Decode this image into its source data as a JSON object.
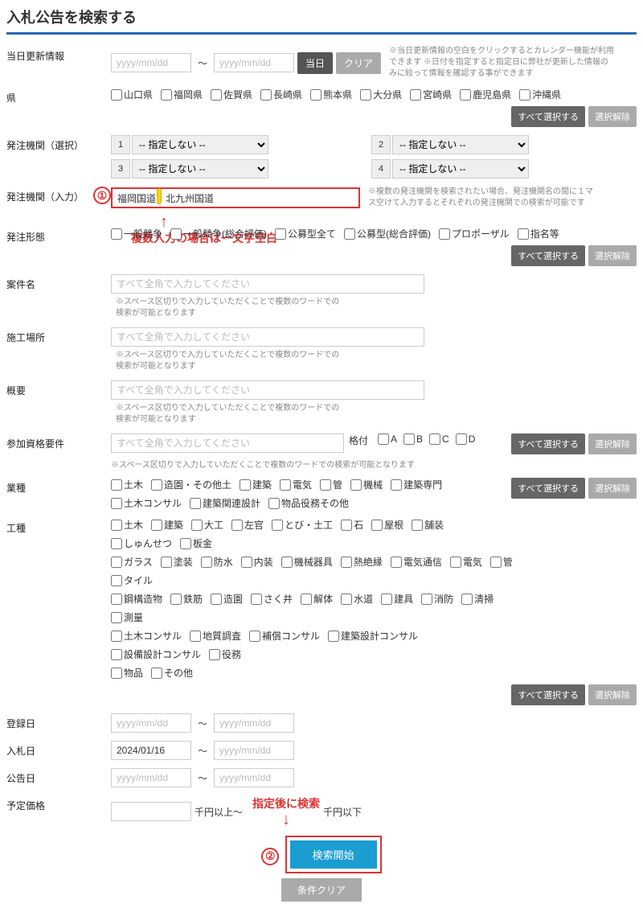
{
  "page_title": "入札公告を検索する",
  "update_info": {
    "label": "当日更新情報",
    "placeholder": "yyyy/mm/dd",
    "today_btn": "当日",
    "clear_btn": "クリア",
    "help": "※当日更新情報の空白をクリックするとカレンダー機能が利用できます\n※日付を指定すると指定日に弊社が更新した情報のみに絞って情報を確認する事ができます"
  },
  "prefectures": {
    "label": "県",
    "items": [
      "山口県",
      "福岡県",
      "佐賀県",
      "長崎県",
      "熊本県",
      "大分県",
      "宮崎県",
      "鹿児島県",
      "沖縄県"
    ],
    "all": "すべて選択する",
    "none": "選択解除"
  },
  "agency_select": {
    "label": "発注機関（選択）",
    "option": "-- 指定しない --",
    "nums": [
      "1",
      "2",
      "3",
      "4"
    ]
  },
  "agency_input": {
    "label": "発注機関（入力）",
    "value": "福岡国道　北九州国道",
    "help": "※複数の発注機関を検索されたい場合、発注機関名の間に１マス空けて入力するとそれぞれの発注機関での検索が可能です",
    "annotation": "複数入力の場合は一文字空白"
  },
  "order_type": {
    "label": "発注形態",
    "items": [
      "一般競争",
      "一般競争(総合評価)",
      "公募型全て",
      "公募型(総合評価)",
      "プロポーザル",
      "指名等"
    ],
    "all": "すべて選択する",
    "none": "選択解除"
  },
  "project_name": {
    "label": "案件名",
    "placeholder": "すべて全角で入力してください",
    "help": "※スペース区切りで入力していただくことで複数のワードでの検索が可能となります"
  },
  "location": {
    "label": "施工場所",
    "placeholder": "すべて全角で入力してください",
    "help": "※スペース区切りで入力していただくことで複数のワードでの検索が可能となります"
  },
  "summary": {
    "label": "概要",
    "placeholder": "すべて全角で入力してください",
    "help": "※スペース区切りで入力していただくことで複数のワードでの検索が可能となります"
  },
  "qualification": {
    "label": "参加資格要件",
    "placeholder": "すべて全角で入力してください",
    "grade_label": "格付",
    "grades": [
      "A",
      "B",
      "C",
      "D"
    ],
    "all": "すべて選択する",
    "none": "選択解除",
    "note": "※スペース区切りで入力していただくことで複数のワードでの検索が可能となります"
  },
  "industry": {
    "label": "業種",
    "items": [
      "土木",
      "造園・その他土",
      "建築",
      "電気",
      "管",
      "機械",
      "建築専門",
      "土木コンサル",
      "建築関連設計",
      "物品役務その他"
    ],
    "all": "すべて選択する",
    "none": "選択解除"
  },
  "work_type": {
    "label": "工種",
    "rows": [
      [
        "土木",
        "建築",
        "大工",
        "左官",
        "とび・土工",
        "石",
        "屋根",
        "舗装",
        "しゅんせつ",
        "板金"
      ],
      [
        "ガラス",
        "塗装",
        "防水",
        "内装",
        "機械器具",
        "熱絶縁",
        "電気通信",
        "電気",
        "管",
        "タイル"
      ],
      [
        "鋼構造物",
        "鉄筋",
        "造園",
        "さく井",
        "解体",
        "水道",
        "建具",
        "消防",
        "清掃",
        "測量"
      ],
      [
        "土木コンサル",
        "地質調査",
        "補償コンサル",
        "建築設計コンサル",
        "設備設計コンサル",
        "役務"
      ],
      [
        "物品",
        "その他"
      ]
    ],
    "all": "すべて選択する",
    "none": "選択解除"
  },
  "reg_date": {
    "label": "登録日",
    "ph": "yyyy/mm/dd"
  },
  "bid_date": {
    "label": "入札日",
    "value": "2024/01/16",
    "ph": "yyyy/mm/dd"
  },
  "notice_date": {
    "label": "公告日",
    "ph": "yyyy/mm/dd"
  },
  "price": {
    "label": "予定価格",
    "unit_from": "千円以上～",
    "unit_to": "千円以下"
  },
  "search_annotation": "指定後に検索",
  "search_btn": "検索開始",
  "clear_btn": "条件クリア",
  "circles": {
    "one": "①",
    "two": "②"
  },
  "tilde": "～"
}
